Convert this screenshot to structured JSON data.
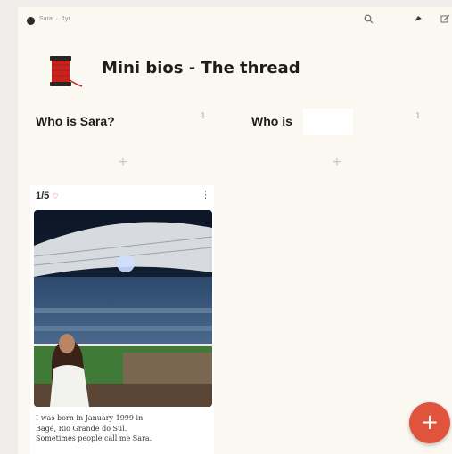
{
  "header": {
    "breadcrumb": [
      "Sara",
      "·",
      "1yr"
    ],
    "search_icon": "search-icon",
    "share_icon": "share-icon",
    "edit_icon": "edit-icon"
  },
  "board": {
    "title": "Mini bios - The thread",
    "title_icon": "thread-spool-icon"
  },
  "columns": [
    {
      "title": "Who is Sara?",
      "count": "1",
      "add_icon": "plus-icon"
    },
    {
      "title": "Who is",
      "count": "1",
      "add_icon": "plus-icon"
    }
  ],
  "card": {
    "count": "1/5",
    "heart_icon": "heart-icon",
    "menu_icon": "kebab-menu-icon",
    "text_lines": [
      "I was born in January 1999 in",
      "Bagé, Rio Grande do Sul.",
      "Sometimes people call me Sara."
    ]
  },
  "fab": {
    "label": "+"
  },
  "colors": {
    "board_bg": "#fbf8f2",
    "card_bg": "#ffffff",
    "fab": "#e0533d",
    "spool_red": "#c9221e"
  }
}
